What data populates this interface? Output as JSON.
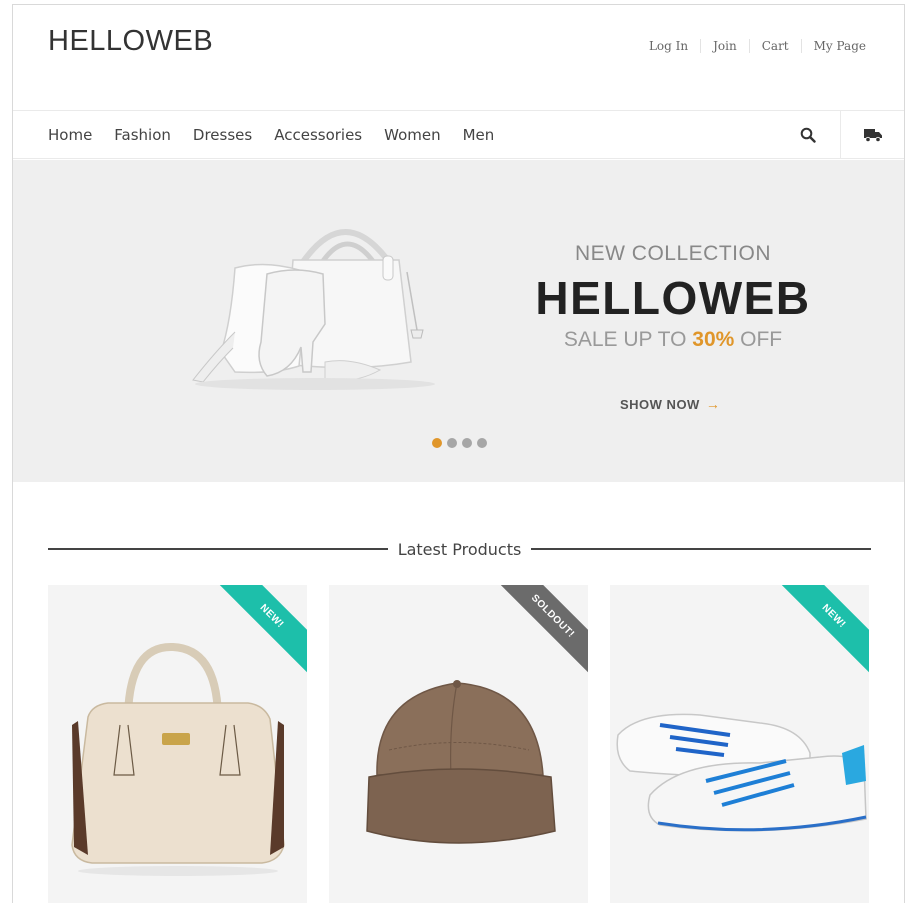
{
  "header": {
    "logo": "HELLOWEB",
    "links": [
      "Log In",
      "Join",
      "Cart",
      "My Page"
    ]
  },
  "nav": {
    "items": [
      "Home",
      "Fashion",
      "Dresses",
      "Accessories",
      "Women",
      "Men"
    ],
    "icons": [
      "search-icon",
      "truck-icon"
    ]
  },
  "hero": {
    "subtitle": "NEW COLLECTION",
    "title": "HELLOWEB",
    "sale_prefix": "SALE UP TO ",
    "sale_percent": "30%",
    "sale_suffix": " OFF",
    "cta": "SHOW NOW",
    "cta_arrow": "→",
    "slides": 4,
    "active_slide": 1
  },
  "section": {
    "title": "Latest Products"
  },
  "products": [
    {
      "badge": "NEW!",
      "image": "handbag"
    },
    {
      "badge": "SOLDOUT!",
      "image": "cap"
    },
    {
      "badge": "NEW!",
      "image": "sneakers"
    }
  ],
  "colors": {
    "accent": "#e0962a",
    "new_badge": "#1dbfaa",
    "soldout_badge": "#6b6b6b",
    "hero_bg": "#efefef"
  }
}
